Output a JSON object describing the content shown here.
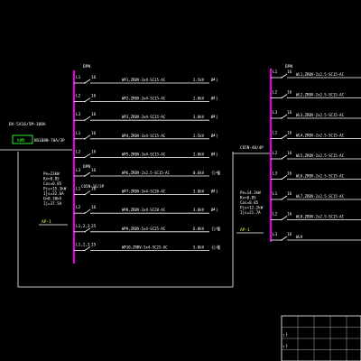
{
  "colors": {
    "background": "#000000",
    "busbar": "#e000e0",
    "wire": "#ffffff",
    "label": "#ffffff",
    "annotation": "#ffff40",
    "incomer_box": "#33ff33",
    "frame": "#ffffff",
    "title_block_lines": "#aaaaaa"
  },
  "panel_left": {
    "incoming_spec": "BV-5X16/5M-100A",
    "meter_label": "kWh",
    "main_breaker": "NS100N-70A/3P",
    "bus_tag": "DPN",
    "bus_tag_mid": "DPN",
    "load_params": [
      "Pe=23kW",
      "Kx=0.85",
      "Cos=0.85",
      "Pjs=15.3kW",
      "Ijs=32.6A",
      "U=0.38kV",
      "Ij=37.5A"
    ],
    "panel_id": "AP-1",
    "spare_breaker": "C65N-16/3P",
    "circuits": [
      {
        "phase": "L1",
        "cb": "16",
        "cable": "WP1,ZRBV-3x4-SC15-AC",
        "power": "2.5kV",
        "load": "Ø╝├"
      },
      {
        "phase": "L2",
        "cb": "16",
        "cable": "WP2,ZRBV-3x4-SC15-AC",
        "power": "2.0kV",
        "load": "Ø╝├"
      },
      {
        "phase": "L3",
        "cb": "16",
        "cable": "WP3,ZRBV-3x4-SC15-AC",
        "power": "3.0kV",
        "load": "Ø╝├"
      },
      {
        "phase": "L1",
        "cb": "16",
        "cable": "WP4,ZRBV-3x4-SC15-AC",
        "power": "2.5kV",
        "load": "Ø╝├"
      },
      {
        "phase": "L2",
        "cb": "16",
        "cable": "WP5,ZRBV-3x4-SC15-AC",
        "power": "2.0kV",
        "load": "Ø╝├"
      },
      {
        "phase": "L3",
        "cb": "16",
        "cable": "WP6,ZRBV-2x2.5-SC15-AC",
        "power": "0.6kV",
        "load": "┤░┴▒"
      },
      {
        "phase": "L1",
        "cb": "16",
        "cable": "WP7,ZRBV-3x4-SC20-AC",
        "power": "3.0kV",
        "load": "Ø╝├"
      },
      {
        "phase": "L2",
        "cb": "16",
        "cable": "WP8,ZRBV-3x4-SC20-AC",
        "power": "3.0kV",
        "load": "Ø╝├"
      },
      {
        "phase": "L1,2,3",
        "cb": "25",
        "cable": "WP9,ZRBV-5x4-SC25-AC",
        "power": "6.0kV",
        "load": "┤░┴▒"
      },
      {
        "phase": "L1,2,3",
        "cb": "25",
        "cable": "WP10,ZRBV-5x4-SC25-AC",
        "power": "5.0kV",
        "load": "┤░┴▒"
      }
    ]
  },
  "panel_right": {
    "bus_tag": "DPN",
    "main_breaker": "C65N-40/4P",
    "load_params": [
      "Pe=14.3kW",
      "Kx=0.85",
      "Cos=0.85",
      "Pjs=12.2kW",
      "Ijs=21.7A"
    ],
    "panel_id": "AP-1",
    "circuits": [
      {
        "phase": "L1",
        "cb": "16",
        "cable": "WL1,ZRBV-2x2.5-SC15-AC"
      },
      {
        "phase": "L2",
        "cb": "16",
        "cable": "WL2,ZRBV-2x2.5-SC15-AC"
      },
      {
        "phase": "L3",
        "cb": "16",
        "cable": "WL3,ZRBV-2x2.5-SC15-AC"
      },
      {
        "phase": "L1",
        "cb": "16",
        "cable": "WL4,ZRBV-2x2.5-SC15-AC"
      },
      {
        "phase": "L2",
        "cb": "16",
        "cable": "WL5,ZRBV-2x2.5-SC15-AC"
      },
      {
        "phase": "L3",
        "cb": "16",
        "cable": "WL6,ZRBV-2x2.5-SC15-AC"
      },
      {
        "phase": "L1",
        "cb": "16",
        "cable": "WL7,ZRBV-2x2.5-SC15-AC"
      },
      {
        "phase": "L2",
        "cb": "16",
        "cable": "WL8,ZRBV-2x2.5-SC15-AC"
      },
      {
        "phase": "L3",
        "cb": "16",
        "cable": "WL9"
      }
    ]
  },
  "title_block": {
    "rows": [
      [
        "",
        "",
        "",
        "",
        ""
      ],
      [
        "┐├",
        "",
        "",
        "",
        ""
      ],
      [
        "┐├",
        "",
        "",
        "",
        ""
      ],
      [
        "",
        "",
        "",
        "",
        ""
      ]
    ]
  }
}
